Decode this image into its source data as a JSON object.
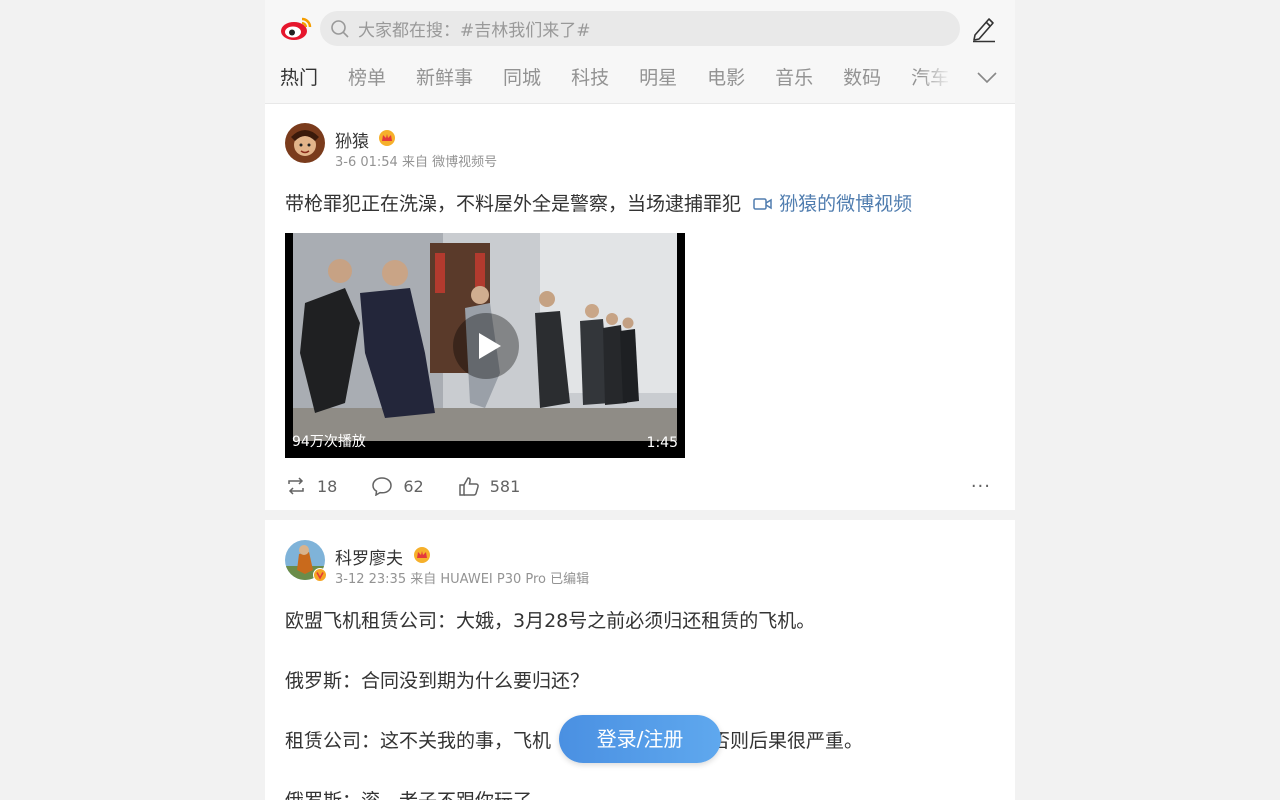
{
  "header": {
    "search_placeholder": "大家都在搜：#吉林我们来了#",
    "tabs": [
      "热门",
      "榜单",
      "新鲜事",
      "同城",
      "科技",
      "明星",
      "电影",
      "音乐",
      "数码",
      "汽车"
    ]
  },
  "posts": [
    {
      "username": "狲猿",
      "meta": "3-6 01:54 来自 微博视频号",
      "text": "带枪罪犯正在洗澡，不料屋外全是警察，当场逮捕罪犯",
      "link": "狲猿的微博视频",
      "video": {
        "plays": "94万次播放",
        "duration": "1:45"
      },
      "reposts": "18",
      "comments": "62",
      "likes": "581"
    },
    {
      "username": "科罗廖夫",
      "meta": "3-12 23:35 来自 HUAWEI P30 Pro 已编辑",
      "lines": [
        "欧盟飞机租赁公司：大娥，3月28号之前必须归还租赁的飞机。",
        "俄罗斯：合同没到期为什么要归还？",
        "租赁公司：这不关我的事，飞机",
        "否则后果很严重。",
        "俄罗斯：滚，老子不跟你玩了"
      ]
    }
  ],
  "login_button": "登录/注册"
}
